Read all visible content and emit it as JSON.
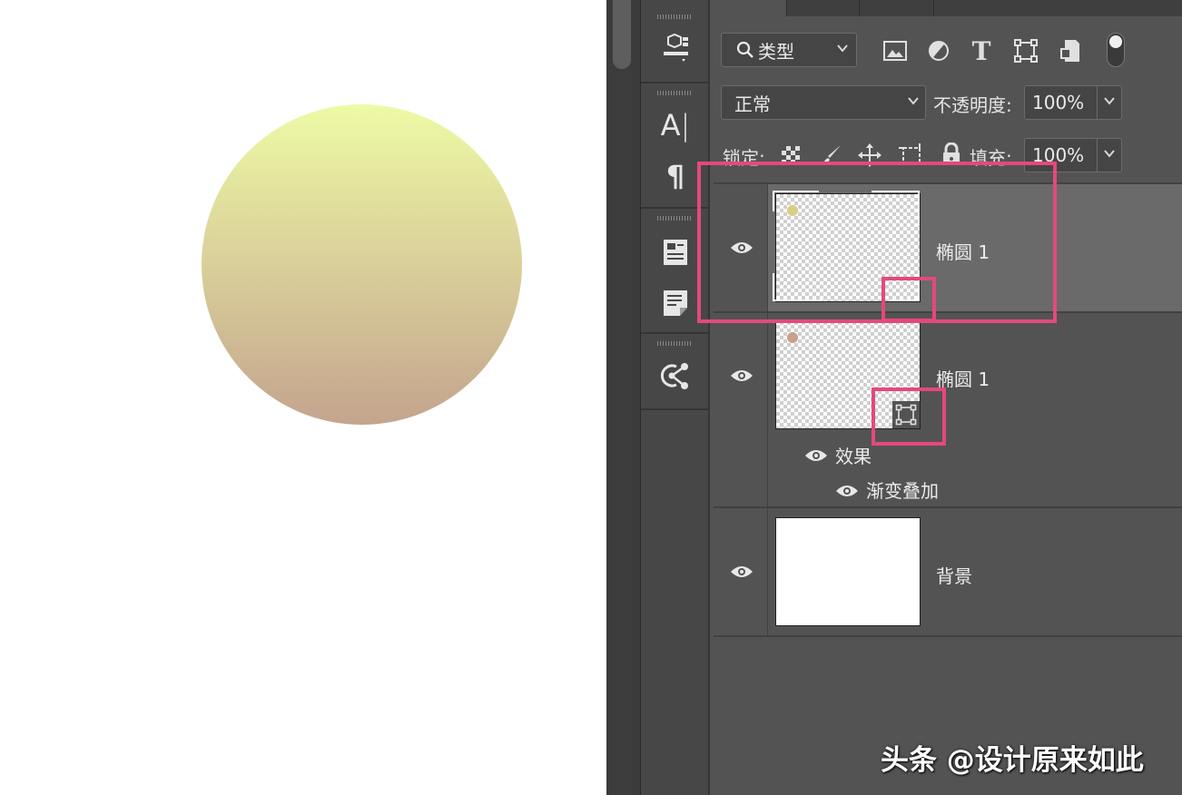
{
  "canvas": {
    "circle_gradient_top": "#eefaa5",
    "circle_gradient_bottom": "#c4a48e"
  },
  "filter_bar": {
    "kind_label": "类型",
    "icons": [
      "image-filter-icon",
      "adjustment-filter-icon",
      "type-filter-icon",
      "shape-filter-icon",
      "smart-object-filter-icon",
      "filter-toggle"
    ]
  },
  "blend_row": {
    "blend_mode": "正常",
    "opacity_label": "不透明度:",
    "opacity_value": "100%"
  },
  "lock_row": {
    "lock_label": "锁定:",
    "fill_label": "填充:",
    "fill_value": "100%"
  },
  "layers": [
    {
      "name": "椭圆 1",
      "dot_color": "#d7cf86",
      "selected": true
    },
    {
      "name": "椭圆 1",
      "dot_color": "#c8a28c",
      "selected": false,
      "effects_label": "效果",
      "effect_name": "渐变叠加"
    },
    {
      "name": "背景",
      "selected": false
    }
  ],
  "highlight_color": "#e4497a",
  "watermark": {
    "text": "头条 @设计原来如此"
  }
}
